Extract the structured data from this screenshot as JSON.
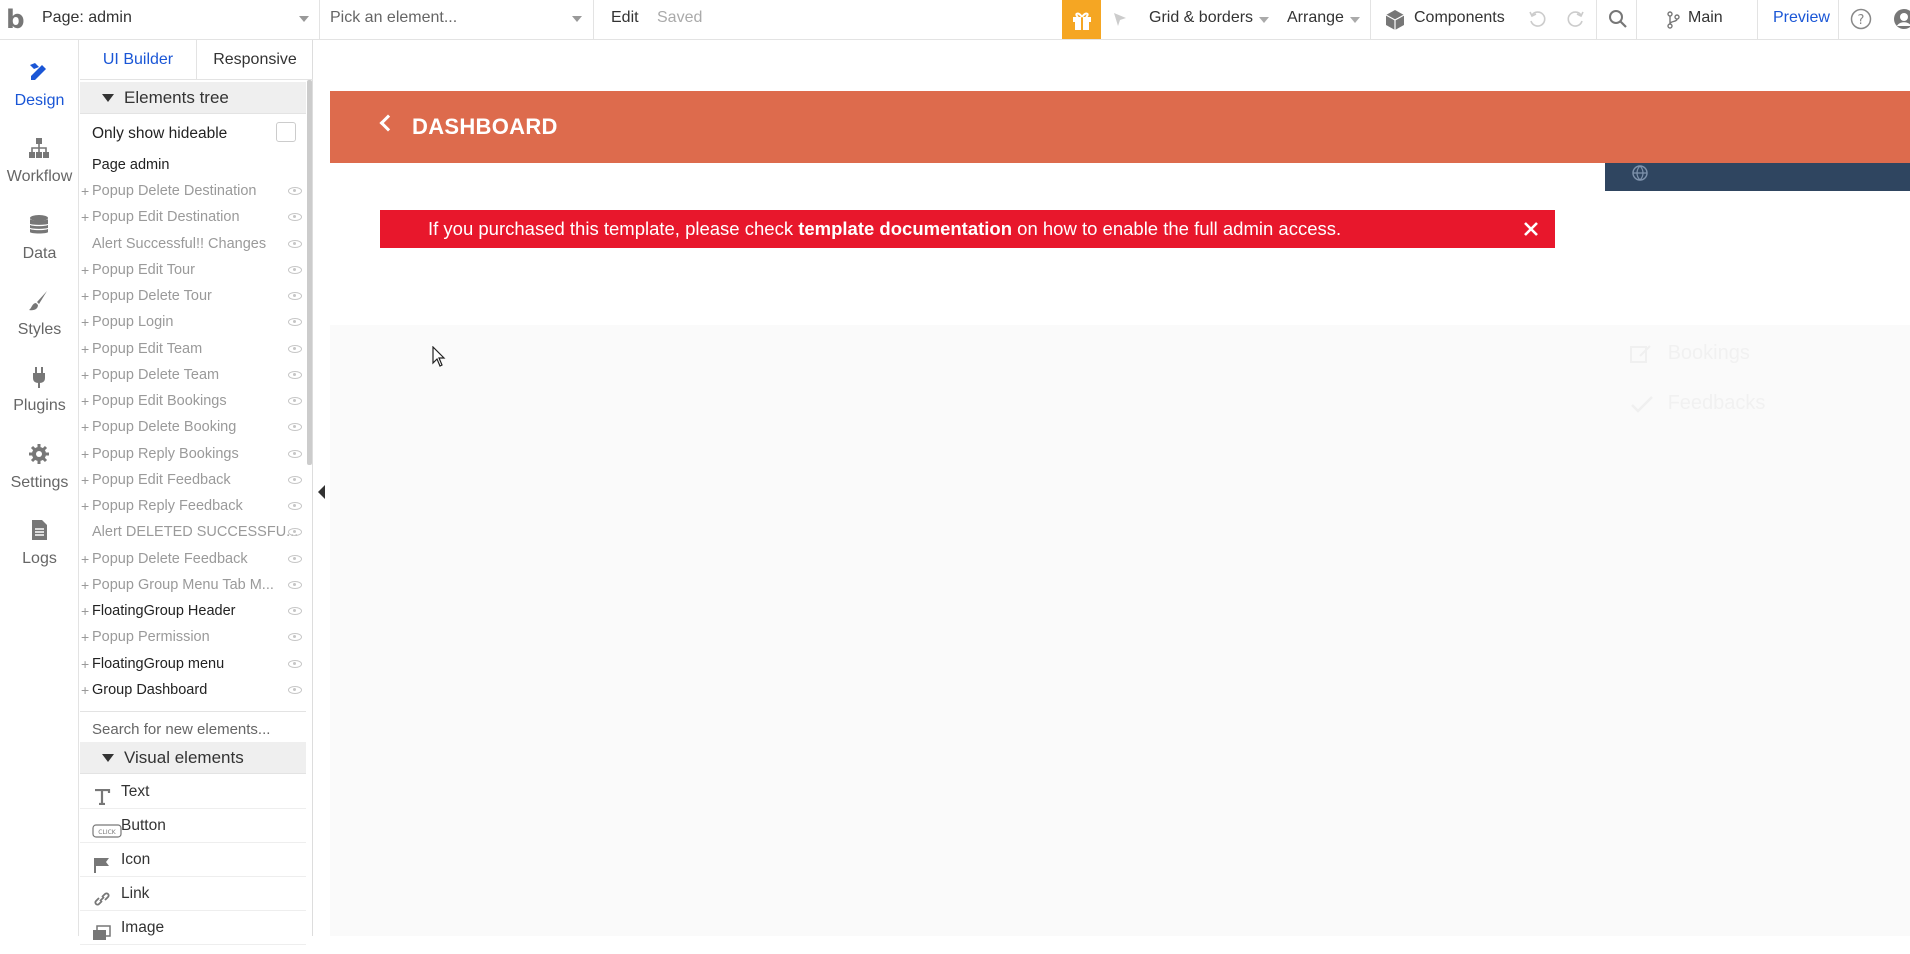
{
  "topbar": {
    "page_select": "Page: admin",
    "element_select_placeholder": "Pick an element...",
    "edit": "Edit",
    "saved": "Saved",
    "grid_borders": "Grid & borders",
    "arrange": "Arrange",
    "components": "Components",
    "branch": "Main",
    "preview": "Preview"
  },
  "rail": {
    "items": [
      {
        "label": "Design",
        "icon": "design-icon",
        "active": true
      },
      {
        "label": "Workflow",
        "icon": "workflow-icon"
      },
      {
        "label": "Data",
        "icon": "data-icon"
      },
      {
        "label": "Styles",
        "icon": "styles-icon"
      },
      {
        "label": "Plugins",
        "icon": "plugins-icon"
      },
      {
        "label": "Settings",
        "icon": "settings-icon"
      },
      {
        "label": "Logs",
        "icon": "logs-icon"
      }
    ]
  },
  "panel": {
    "tabs": [
      "UI Builder",
      "Responsive"
    ],
    "elements_tree_header": "Elements tree",
    "only_show_hideable": "Only show hideable",
    "tree": [
      {
        "label": "Page admin"
      },
      {
        "label": "Popup Delete Destination"
      },
      {
        "label": "Popup Edit Destination"
      },
      {
        "label": "Alert Successful!! Changes"
      },
      {
        "label": "Popup Edit Tour"
      },
      {
        "label": "Popup Delete Tour"
      },
      {
        "label": "Popup Login"
      },
      {
        "label": "Popup Edit Team"
      },
      {
        "label": "Popup Delete Team"
      },
      {
        "label": "Popup Edit Bookings"
      },
      {
        "label": "Popup Delete Booking"
      },
      {
        "label": "Popup Reply Bookings"
      },
      {
        "label": "Popup Edit Feedback"
      },
      {
        "label": "Popup Reply Feedback"
      },
      {
        "label": "Alert DELETED SUCCESSFU..."
      },
      {
        "label": "Popup Delete Feedback"
      },
      {
        "label": "Popup Group Menu Tab M..."
      },
      {
        "label": "FloatingGroup Header"
      },
      {
        "label": "Popup Permission"
      },
      {
        "label": "FloatingGroup menu"
      },
      {
        "label": "Group Dashboard"
      }
    ],
    "search_placeholder": "Search for new elements...",
    "visual_elements_header": "Visual elements",
    "visual_elements": [
      {
        "label": "Text",
        "icon": "text-icon"
      },
      {
        "label": "Button",
        "icon": "button-icon"
      },
      {
        "label": "Icon",
        "icon": "flag-icon"
      },
      {
        "label": "Link",
        "icon": "link-icon"
      },
      {
        "label": "Image",
        "icon": "image-icon"
      }
    ]
  },
  "canvas": {
    "dashboard_title": "DASHBOARD",
    "alert": {
      "before": "If you purchased this template, please check ",
      "bold": "template documentation",
      "after": " on how to enable the full admin access."
    },
    "ghost_menu": [
      "Bookings",
      "Feedbacks"
    ]
  },
  "colors": {
    "accent": "#1a56d6",
    "dashboard_bar": "#dd6b4d",
    "alert": "#e8172c",
    "navy": "#2f4560",
    "gift": "#f5a623"
  }
}
